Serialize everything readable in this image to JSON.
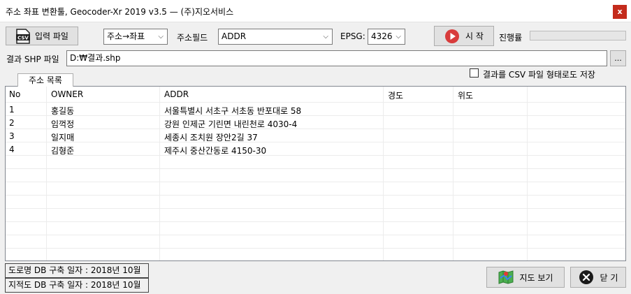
{
  "window": {
    "title": "주소 좌표 변환툴, Geocoder-Xr 2019 v3.5 — (주)지오서비스",
    "close_label": "x"
  },
  "toolbar": {
    "input_file_label": "입력 파일",
    "csv_icon_text": "CSV",
    "mode_value": "주소→좌표",
    "address_field_label": "주소필드",
    "address_field_value": "ADDR",
    "epsg_label": "EPSG:",
    "epsg_value": "4326",
    "start_label": "시 작",
    "progress_label": "진행률",
    "progress_value": 0
  },
  "output": {
    "shp_label": "결과 SHP 파일",
    "shp_path": "D:₩결과.shp",
    "browse_label": "...",
    "csv_option_label": "결과를 CSV 파일 형태로도 저장",
    "csv_option_checked": false
  },
  "tab": {
    "label": "주소 목록"
  },
  "table": {
    "columns": [
      "No",
      "OWNER",
      "ADDR",
      "경도",
      "위도"
    ],
    "rows": [
      [
        "1",
        "홍길동",
        "서울특별시 서초구 서초동 반포대로 58",
        "",
        ""
      ],
      [
        "2",
        "임꺽정",
        "강원 인제군 기린면 내린천로 4030-4",
        "",
        ""
      ],
      [
        "3",
        "일지매",
        "세종시 조치원 장안2길 37",
        "",
        ""
      ],
      [
        "4",
        "김형준",
        "제주시 중산간동로 4150-30",
        "",
        ""
      ]
    ]
  },
  "status": {
    "road_db": "도로명 DB 구축 일자 : 2018년 10월",
    "cadastral_db": "지적도 DB 구축 일자 : 2018년 10월"
  },
  "buttons": {
    "map_view_label": "지도 보기",
    "close_label": "닫 기"
  },
  "colors": {
    "start_icon": "#d83b3b",
    "close_icon": "#1a1a1a",
    "progress_fill": "#06b025"
  }
}
